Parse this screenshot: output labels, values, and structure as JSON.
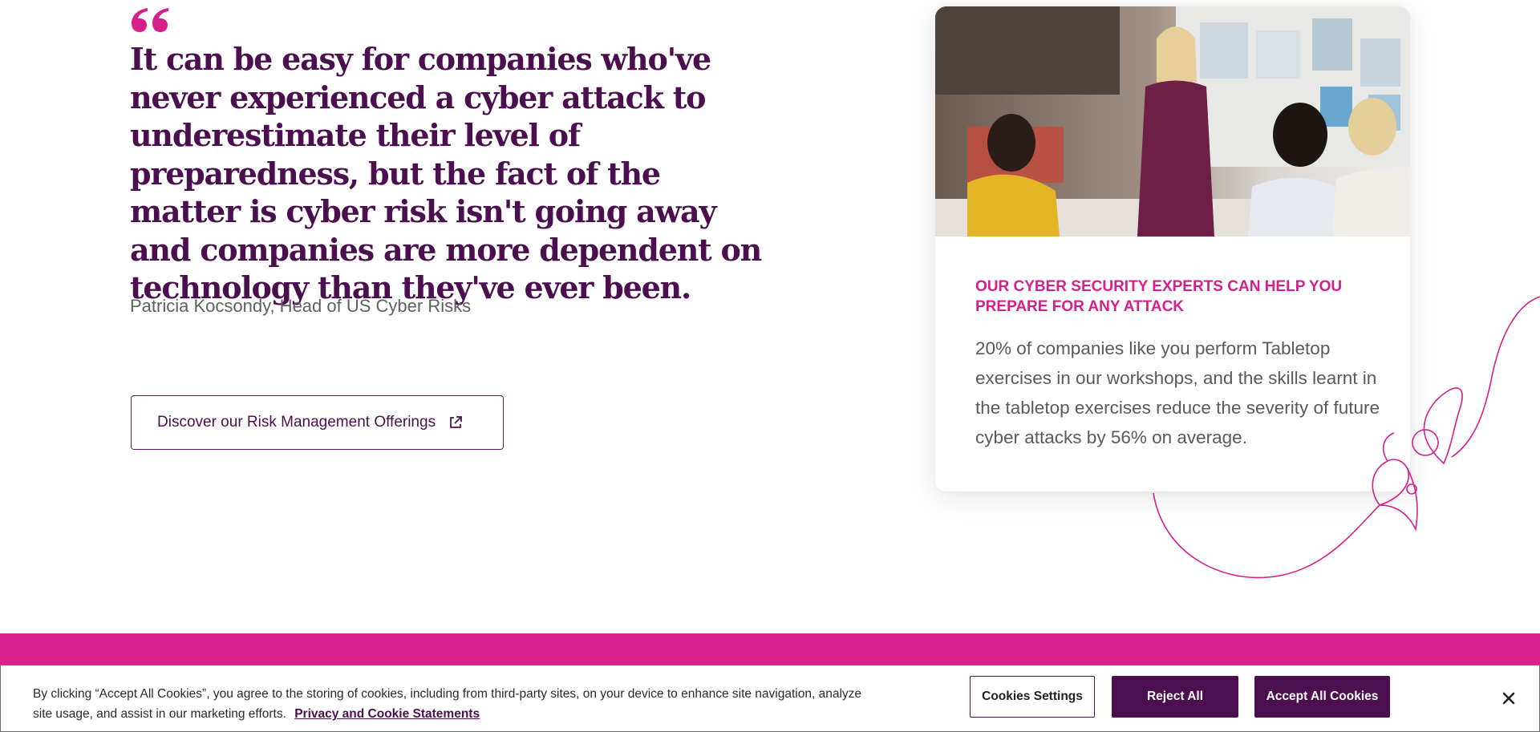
{
  "quote": {
    "text": "It can be easy for companies who've never experienced a cyber attack to underestimate their level of preparedness, but the fact of the matter is cyber risk isn't going away and companies are more dependent on technology than they've ever been.",
    "attribution": "Patricia Kocsondy, Head of US Cyber Risks",
    "icon": "quote-icon"
  },
  "cta": {
    "label": "Discover our Risk Management Offerings",
    "icon": "external-link-icon"
  },
  "card": {
    "heading": "Our cyber security experts can help you prepare for any attack",
    "body": "20% of companies like you perform Tabletop exercises in our workshops, and the skills learnt in the tabletop exercises reduce the severity of future cyber attacks by 56% on average."
  },
  "cookie_banner": {
    "text": "By clicking “Accept All Cookies”, you agree to the storing of cookies, including from third-party sites, on your device to enhance site navigation, analyze site usage, and assist in our marketing efforts.",
    "link_label": "Privacy and Cookie Statements",
    "settings_label": "Cookies Settings",
    "reject_label": "Reject All",
    "accept_label": "Accept All Cookies",
    "close_icon": "close-icon"
  },
  "colors": {
    "brand_purple": "#4b0f4f",
    "brand_magenta": "#d8218d",
    "heading_magenta": "#d61f8b"
  }
}
